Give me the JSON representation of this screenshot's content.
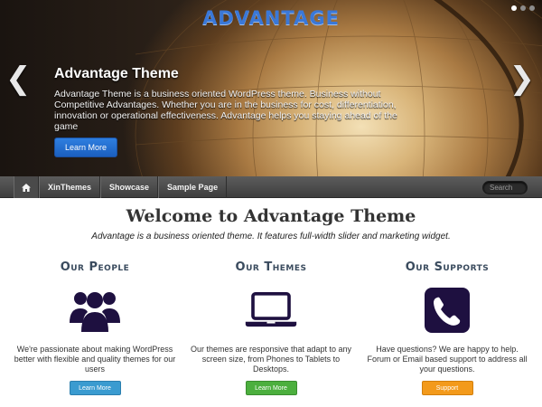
{
  "colors": {
    "logo": "#3a78d8",
    "primary_button": "#1f66c6",
    "nav_bg": "#4a4a4a",
    "icon_dark": "#1e1040",
    "btn_blue": "#3a9bd0",
    "btn_green": "#4caf3e",
    "btn_orange": "#f39a1b"
  },
  "hero": {
    "logo": "ADVANTAGE",
    "title": "Advantage Theme",
    "text": "Advantage Theme is a business oriented WordPress theme. Business without Competitive Advantages. Whether you are in the business for cost, differentiation, innovation or operational effectiveness. Advantage helps you staying ahead of the game",
    "button_label": "Learn More",
    "prev_arrow": "❮",
    "next_arrow": "❯",
    "slide_count": 3,
    "active_slide": 1
  },
  "nav": {
    "home_icon": "home-icon",
    "items": [
      "XinThemes",
      "Showcase",
      "Sample Page"
    ],
    "search_placeholder": "Search"
  },
  "welcome": {
    "title": "Welcome to Advantage Theme",
    "subtitle": "Advantage is a business oriented theme. It features full-width slider and marketing widget."
  },
  "features": [
    {
      "title": "Our People",
      "icon": "people-icon",
      "text": "We're passionate about making WordPress better with flexible and quality themes for our users",
      "button_label": "Learn More",
      "button_color": "#3a9bd0"
    },
    {
      "title": "Our Themes",
      "icon": "laptop-icon",
      "text": "Our themes are responsive that adapt to any screen size, from Phones to Tablets to Desktops.",
      "button_label": "Learn More",
      "button_color": "#4caf3e"
    },
    {
      "title": "Our Supports",
      "icon": "phone-icon",
      "text": "Have questions? We are happy to help. Forum or Email based support to address all your questions.",
      "button_label": "Support",
      "button_color": "#f39a1b"
    }
  ]
}
